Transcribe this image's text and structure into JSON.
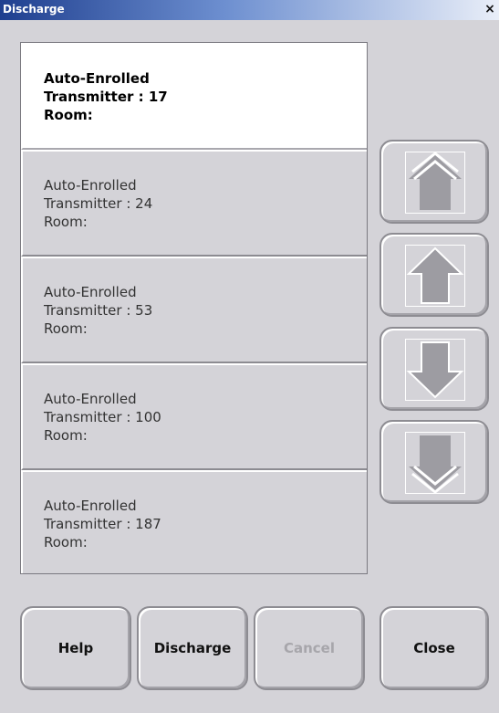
{
  "window": {
    "title": "Discharge",
    "close_glyph": "×"
  },
  "list": {
    "items": [
      {
        "name": "Auto-Enrolled",
        "transmitter": "Transmitter : 17",
        "room": "Room:",
        "selected": true
      },
      {
        "name": "Auto-Enrolled",
        "transmitter": "Transmitter : 24",
        "room": "Room:",
        "selected": false
      },
      {
        "name": "Auto-Enrolled",
        "transmitter": "Transmitter : 53",
        "room": "Room:",
        "selected": false
      },
      {
        "name": "Auto-Enrolled",
        "transmitter": "Transmitter : 100",
        "room": "Room:",
        "selected": false
      },
      {
        "name": "Auto-Enrolled",
        "transmitter": "Transmitter : 187",
        "room": "Room:",
        "selected": false
      }
    ]
  },
  "scroll_buttons": [
    {
      "icon": "page-up-icon"
    },
    {
      "icon": "arrow-up-icon"
    },
    {
      "icon": "arrow-down-icon"
    },
    {
      "icon": "page-down-icon"
    }
  ],
  "buttons": {
    "help": "Help",
    "discharge": "Discharge",
    "cancel": "Cancel",
    "close": "Close"
  },
  "colors": {
    "titlebar_start": "#1f3f8f",
    "titlebar_end": "#e9eef8",
    "background": "#d4d3d8",
    "selected_row": "#ffffff",
    "arrow_fill": "#9d9ca2",
    "disabled_text": "#a7a6ab"
  }
}
